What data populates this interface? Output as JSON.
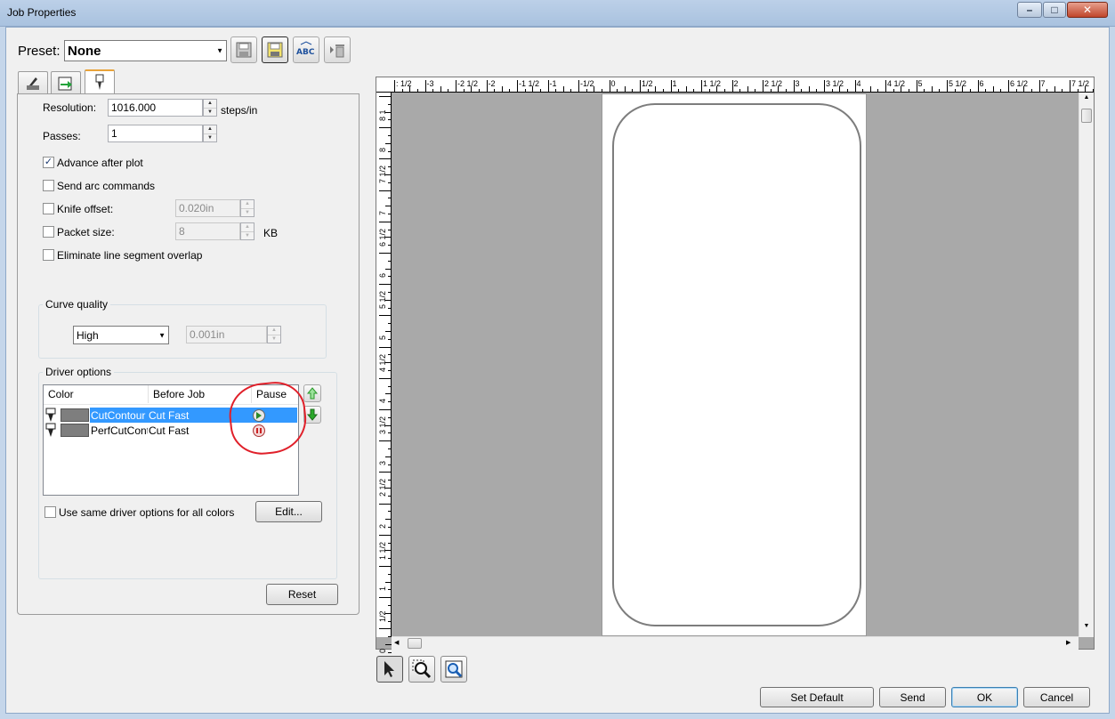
{
  "window": {
    "title": "Job Properties"
  },
  "preset": {
    "label": "Preset:",
    "value": "None",
    "toolbar_icons": [
      "save-icon",
      "save-as-icon",
      "rename-icon",
      "delete-icon"
    ]
  },
  "tabs": [
    {
      "icon": "cutter-icon"
    },
    {
      "icon": "transfer-icon"
    },
    {
      "icon": "knife-icon",
      "active": true
    }
  ],
  "settings": {
    "resolution_label": "Resolution:",
    "resolution_value": "1016.000",
    "resolution_unit": "steps/in",
    "passes_label": "Passes:",
    "passes_value": "1",
    "advance_after_plot": {
      "label": "Advance after plot",
      "checked": true
    },
    "send_arc_commands": {
      "label": "Send arc commands",
      "checked": false
    },
    "knife_offset": {
      "label": "Knife offset:",
      "checked": false,
      "value": "0.020in"
    },
    "packet_size": {
      "label": "Packet size:",
      "checked": false,
      "value": "8",
      "unit": "KB"
    },
    "eliminate_overlap": {
      "label": "Eliminate line segment overlap",
      "checked": false
    }
  },
  "curve_quality": {
    "title": "Curve quality",
    "select_value": "High",
    "tolerance_value": "0.001in"
  },
  "driver_options": {
    "title": "Driver options",
    "columns": [
      "Color",
      "Before Job",
      "Pause"
    ],
    "rows": [
      {
        "name": "CutContour",
        "before_job": "Cut Fast",
        "pause_icon": "play-icon",
        "selected": true
      },
      {
        "name": "PerfCutContour",
        "before_job": "Cut Fast",
        "pause_icon": "pause-icon",
        "selected": false
      }
    ],
    "use_same_label": "Use same driver options for all colors",
    "edit_label": "Edit...",
    "reset_label": "Reset"
  },
  "ruler": {
    "top": [
      ": 1/2",
      "-3",
      "-2 1/2",
      "-2",
      "-1 1/2",
      "-1",
      "-1/2",
      "0",
      "1/2",
      "1",
      "1 1/2",
      "2",
      "2 1/2",
      "3",
      "3 1/2",
      "4",
      "4 1/2",
      "5",
      "5 1/2",
      "6",
      "6 1/2",
      "7",
      "7 1/2"
    ],
    "left": [
      "8 1",
      "8",
      "7 1/2",
      "7",
      "6 1/2",
      "6",
      "5 1/2",
      "5",
      "4 1/2",
      "4",
      "3 1/2",
      "3",
      "2 1/2",
      "2",
      "1 1/2",
      "1",
      "1/2",
      "0"
    ]
  },
  "bottom_tools": [
    "select-arrow-icon",
    "zoom-icon",
    "zoom-fit-icon"
  ],
  "footer": {
    "set_default": "Set Default",
    "send": "Send",
    "ok": "OK",
    "cancel": "Cancel"
  }
}
